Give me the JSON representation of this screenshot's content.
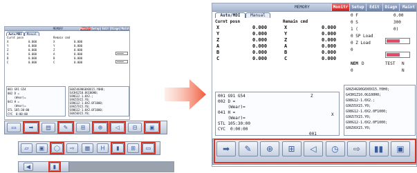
{
  "header": {
    "memory_label": "MEMORY",
    "tabs": [
      "Monitr",
      "Setup",
      "Edit",
      "Diagn",
      "Maint"
    ],
    "active_tab": "Monitr"
  },
  "left_tabs": [
    "Auto/MDI",
    "Manual"
  ],
  "current_posn": {
    "title": "Curnt posn",
    "axes": [
      "X",
      "Y",
      "Z",
      "A",
      "B",
      "C"
    ],
    "values": [
      "0.000",
      "0.000",
      "0.000",
      "0.000",
      "0.000",
      "0.000"
    ]
  },
  "remain_cmd": {
    "title": "Remain cmd",
    "axes": [
      "X",
      "Y",
      "Z",
      "A",
      "B",
      "C"
    ],
    "values": [
      "0.000",
      "0.000",
      "0.000",
      "0.000",
      "0.000",
      "0.000"
    ]
  },
  "feed_panel": {
    "rows": [
      "0 F",
      "0 S",
      "1 (",
      "0 SP Load",
      "0 Z Load",
      "0"
    ],
    "values": [
      "0.00",
      "300",
      "0)",
      "",
      "",
      ""
    ]
  },
  "program_info": {
    "labels": [
      "NEM",
      "0",
      "TEST",
      "N"
    ],
    "values": [
      "D",
      "0",
      "N",
      "0"
    ]
  },
  "modal_block": {
    "lines": [
      "001 G91 G54",
      "002 D =",
      "    (Wear)=",
      "041 H =",
      "    (Wear)=",
      "STL 105:30:00",
      "CYC  0:00:00"
    ]
  },
  "z_label": "Z",
  "x_label": "X",
  "o_label": "001",
  "program_list": [
    "G0G54G90G0X0X15.Y0H0;",
    "G43H1Z10.0G100H0;",
    "G98G12-1.0X2.;",
    "G9G55X15.Y0;",
    "G98G12-1.0X2.0F1000;",
    "G9G57X15.Y0;",
    "G90G12-1.0X2.0F1000;",
    "G0G56X15.Y0;"
  ],
  "softkeys": {
    "names": [
      "prog-run",
      "trace",
      "tool-offset",
      "coord",
      "search",
      "clock",
      "next-page",
      "workpiece",
      "menu-more"
    ],
    "glyphs": [
      "➡",
      "✎",
      "⊕",
      "⊞",
      "◁",
      "◷",
      "⇨",
      "▮▮",
      "▣"
    ]
  },
  "small_softkeys_row1": [
    "▭",
    "➡",
    "▤",
    "✎",
    "⊞",
    "⊕",
    "◁",
    "⊟",
    "▣"
  ],
  "small_softkeys_row2": [
    "▱",
    "▣",
    "◯",
    "⇨",
    "▦",
    "H",
    "▮",
    "⊞",
    "▭"
  ],
  "small_softkeys_row3": [
    "◀",
    "▮"
  ],
  "colors": {
    "accent": "#e03020",
    "arrow": "#f05a3a",
    "bar": "#e24c6a"
  }
}
